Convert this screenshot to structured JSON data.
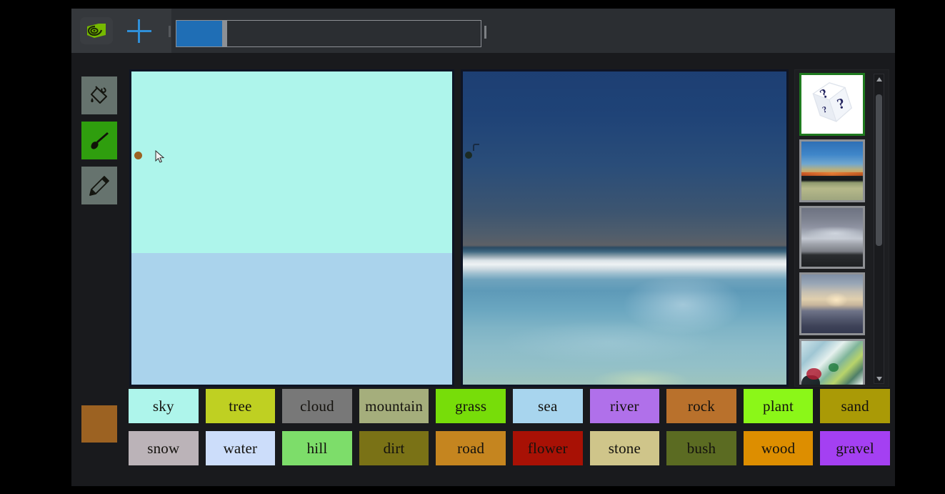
{
  "app": {
    "title": "GauGAN Semantic Image Painter",
    "window_bg": "#191a1d",
    "accent_green": "#2f9e0e",
    "accent_blue": "#2f8fd8"
  },
  "header": {
    "brand_icon": "nvidia-eye-logo",
    "brand_color": "#76b900",
    "new_tab_icon": "plus-icon",
    "new_tab_color": "#2f8fd8",
    "tab_strip": {
      "active_chip_color": "#1f6eb5",
      "handle_color": "#8d9095",
      "border_color": "#8d9095"
    }
  },
  "toolbar": {
    "tools": [
      {
        "name": "paint-bucket-tool",
        "icon": "paint-bucket-icon",
        "selected": false
      },
      {
        "name": "brush-tool",
        "icon": "paintbrush-icon",
        "selected": true
      },
      {
        "name": "pencil-tool",
        "icon": "pencil-icon",
        "selected": false
      }
    ],
    "active_color": "#9c6222",
    "active_color_name": "rock"
  },
  "canvas": {
    "segmentation": {
      "name": "segmentation-canvas",
      "regions": [
        {
          "label": "sky",
          "color": "#aef5eb",
          "coverage_pct": 58
        },
        {
          "label": "sea",
          "color": "#aad3ec",
          "coverage_pct": 42
        }
      ],
      "brush_marker_color": "#9c6222",
      "cursor_icon": "arrow-cursor"
    },
    "preview": {
      "name": "generated-image-preview",
      "description": "Synthesized seascape: deep blue dusk sky above a bright horizon band with calm teal ocean",
      "sky_color": "#1d3f73",
      "horizon_color": "#eef2f4",
      "sea_color": "#6aa6c0"
    }
  },
  "thumbnails": {
    "scrollbar": {
      "position_pct": 3,
      "thumb_size_pct": 53
    },
    "items": [
      {
        "name": "random-style-thumbnail",
        "caption": "random style (dice)",
        "selected": true
      },
      {
        "name": "style-thumbnail-sunset-lake",
        "caption": "sunset over lake",
        "selected": false
      },
      {
        "name": "style-thumbnail-overcast-shore",
        "caption": "overcast shore",
        "selected": false
      },
      {
        "name": "style-thumbnail-hazy-valley",
        "caption": "hazy sunlit valley",
        "selected": false
      },
      {
        "name": "style-thumbnail-abstract-paint",
        "caption": "abstract painted wave",
        "selected": false
      }
    ]
  },
  "palette": {
    "rows": [
      [
        {
          "label": "sky",
          "color": "#aef5eb"
        },
        {
          "label": "tree",
          "color": "#bfd022"
        },
        {
          "label": "cloud",
          "color": "#787878"
        },
        {
          "label": "mountain",
          "color": "#a5ae7c"
        },
        {
          "label": "grass",
          "color": "#77dd09"
        },
        {
          "label": "sea",
          "color": "#a8d5ee"
        },
        {
          "label": "river",
          "color": "#b070ea"
        },
        {
          "label": "rock",
          "color": "#b9712c"
        },
        {
          "label": "plant",
          "color": "#8bf718"
        },
        {
          "label": "sand",
          "color": "#aa9a06"
        }
      ],
      [
        {
          "label": "snow",
          "color": "#bbb3b8"
        },
        {
          "label": "water",
          "color": "#ccddfa"
        },
        {
          "label": "hill",
          "color": "#7ddd6a"
        },
        {
          "label": "dirt",
          "color": "#7a7216"
        },
        {
          "label": "road",
          "color": "#c5851f"
        },
        {
          "label": "flower",
          "color": "#a81105"
        },
        {
          "label": "stone",
          "color": "#cfc58a"
        },
        {
          "label": "bush",
          "color": "#5b6b22"
        },
        {
          "label": "wood",
          "color": "#dd8e00"
        },
        {
          "label": "gravel",
          "color": "#a440f2"
        }
      ]
    ]
  }
}
